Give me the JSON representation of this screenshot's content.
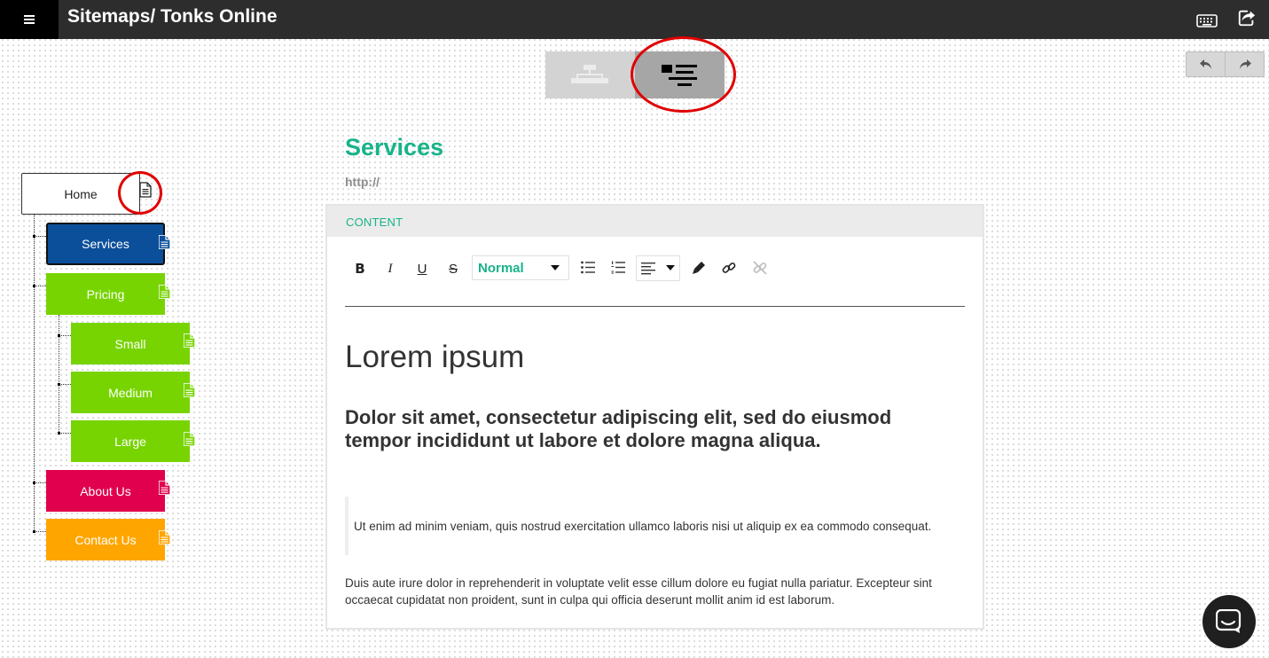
{
  "topbar": {
    "title": "Sitemaps/ Tonks Online",
    "icons": [
      "menu-icon",
      "keyboard-icon",
      "share-icon"
    ]
  },
  "view_toggle": {
    "options": [
      "sitemap-view-icon",
      "content-view-icon"
    ],
    "active": "content-view-icon"
  },
  "history": {
    "icons": [
      "undo-icon",
      "redo-icon"
    ]
  },
  "sitemap": {
    "home": {
      "label": "Home",
      "color": "#ffffff"
    },
    "pages": [
      {
        "label": "Services",
        "color": "#0b4f9a",
        "selected": true
      },
      {
        "label": "Pricing",
        "color": "#77d400"
      },
      {
        "label": "Small",
        "color": "#77d400"
      },
      {
        "label": "Medium",
        "color": "#77d400"
      },
      {
        "label": "Large",
        "color": "#77d400"
      },
      {
        "label": "About Us",
        "color": "#e0004d"
      },
      {
        "label": "Contact Us",
        "color": "#ffa500"
      }
    ]
  },
  "page": {
    "title": "Services",
    "url": "http://",
    "accent": "#18b38a"
  },
  "panel": {
    "section_label": "CONTENT",
    "toolbar": {
      "format_value": "Normal",
      "tools": [
        "bold-icon",
        "italic-icon",
        "underline-icon",
        "strikethrough-icon",
        "bullet-list-icon",
        "numbered-list-icon",
        "align-icon",
        "highlight-icon",
        "link-icon",
        "unlink-icon"
      ]
    },
    "content": {
      "heading1": "Lorem ipsum",
      "heading2": "Dolor sit amet, consectetur adipiscing elit, sed do eiusmod tempor incididunt ut labore et dolore magna aliqua.",
      "quote": "Ut enim ad minim veniam, quis nostrud exercitation ullamco laboris nisi ut aliquip ex ea commodo consequat.",
      "paragraph": "Duis aute irure dolor in reprehenderit in voluptate velit esse cillum dolore eu fugiat nulla pariatur. Excepteur sint occaecat cupidatat non proident, sunt in culpa qui officia deserunt mollit anim id est laborum."
    }
  },
  "chat": {
    "icon": "chat-icon"
  }
}
